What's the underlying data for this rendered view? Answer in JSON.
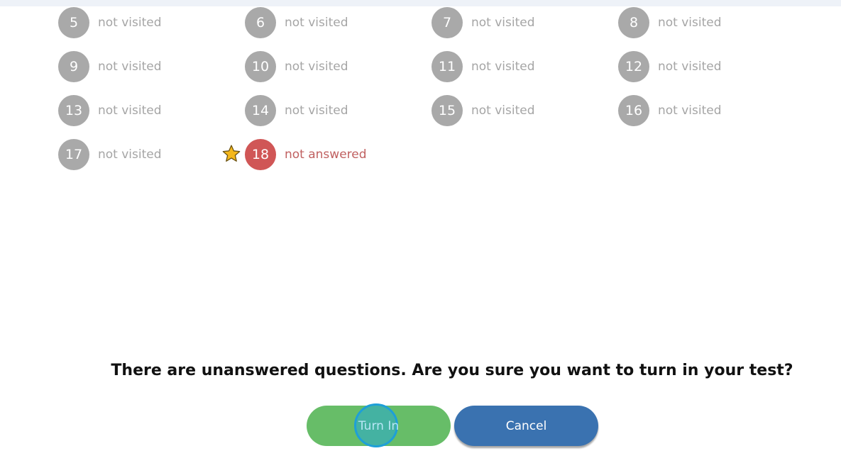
{
  "questions": [
    {
      "number": "5",
      "status": "not visited"
    },
    {
      "number": "6",
      "status": "not visited"
    },
    {
      "number": "7",
      "status": "not visited"
    },
    {
      "number": "8",
      "status": "not visited"
    },
    {
      "number": "9",
      "status": "not visited"
    },
    {
      "number": "10",
      "status": "not visited"
    },
    {
      "number": "11",
      "status": "not visited"
    },
    {
      "number": "12",
      "status": "not visited"
    },
    {
      "number": "13",
      "status": "not visited"
    },
    {
      "number": "14",
      "status": "not visited"
    },
    {
      "number": "15",
      "status": "not visited"
    },
    {
      "number": "16",
      "status": "not visited"
    },
    {
      "number": "17",
      "status": "not visited"
    },
    {
      "number": "18",
      "status": "not answered",
      "flagged": true
    }
  ],
  "dialog": {
    "message": "There are unanswered questions. Are you sure you want to turn in your test?",
    "turn_in_label": "Turn In",
    "cancel_label": "Cancel"
  },
  "colors": {
    "not_visited": "#a9a9a9",
    "not_answered": "#d05656",
    "turn_in": "#67bd68",
    "cancel": "#3a72b0",
    "flag_star": "#f5b81c"
  }
}
